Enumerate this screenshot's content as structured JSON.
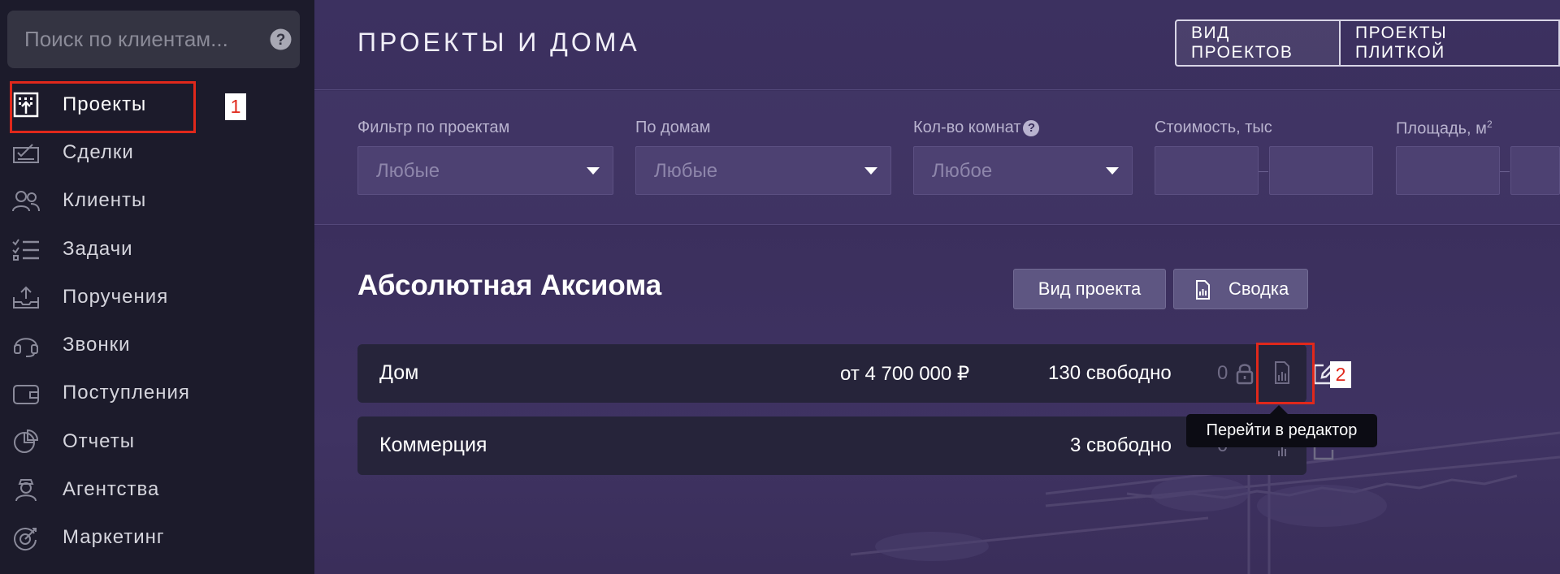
{
  "sidebar": {
    "search_placeholder": "Поиск по клиентам...",
    "items": [
      {
        "label": "Проекты",
        "icon": "building-icon",
        "active": true
      },
      {
        "label": "Сделки",
        "icon": "deal-icon"
      },
      {
        "label": "Клиенты",
        "icon": "clients-icon"
      },
      {
        "label": "Задачи",
        "icon": "tasks-icon"
      },
      {
        "label": "Поручения",
        "icon": "assignments-icon"
      },
      {
        "label": "Звонки",
        "icon": "headset-icon"
      },
      {
        "label": "Поступления",
        "icon": "wallet-icon"
      },
      {
        "label": "Отчеты",
        "icon": "pie-chart-icon"
      },
      {
        "label": "Агентства",
        "icon": "agent-icon"
      },
      {
        "label": "Маркетинг",
        "icon": "target-icon"
      }
    ]
  },
  "annotations": {
    "one": "1",
    "two": "2"
  },
  "header": {
    "title": "ПРОЕКТЫ И ДОМА",
    "view_projects": "ВИД ПРОЕКТОВ",
    "projects_tiles": "ПРОЕКТЫ ПЛИТКОЙ"
  },
  "filters": {
    "projects_label": "Фильтр по проектам",
    "projects_value": "Любые",
    "houses_label": "По домам",
    "houses_value": "Любые",
    "rooms_label": "Кол-во комнат",
    "rooms_value": "Любое",
    "price_label": "Стоимость, тыс",
    "area_label": "Площадь, м",
    "area_sup": "2"
  },
  "project": {
    "name": "Абсолютная Аксиома",
    "view_button": "Вид проекта",
    "summary_button": "Сводка",
    "rows": [
      {
        "name": "Дом",
        "price": "от 4 700 000 ₽",
        "free": "130 свободно",
        "locked": "0"
      },
      {
        "name": "Коммерция",
        "price": "",
        "free": "3 свободно",
        "locked": "0"
      }
    ]
  },
  "tooltip": "Перейти в редактор",
  "colors": {
    "accent_red": "#e0281b",
    "sidebar_bg": "#1c1b2b",
    "main_bg": "#3a2f5c"
  }
}
